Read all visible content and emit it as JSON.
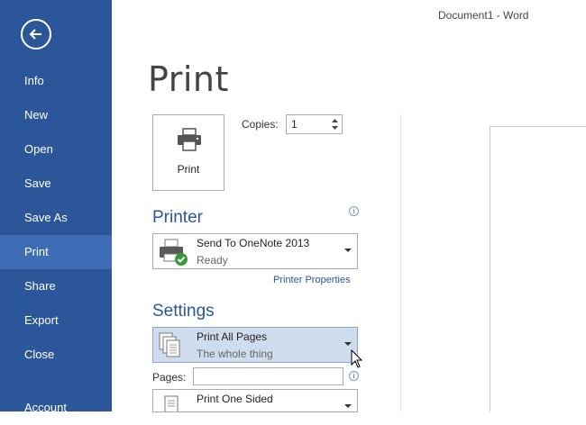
{
  "window": {
    "title": "Document1 - Word"
  },
  "sidebar": {
    "items": [
      {
        "label": "Info"
      },
      {
        "label": "New"
      },
      {
        "label": "Open"
      },
      {
        "label": "Save"
      },
      {
        "label": "Save As"
      },
      {
        "label": "Print",
        "active": true
      },
      {
        "label": "Share"
      },
      {
        "label": "Export"
      },
      {
        "label": "Close"
      },
      {
        "label": "Account"
      }
    ]
  },
  "main": {
    "title": "Print",
    "print_button_label": "Print",
    "copies_label": "Copies:",
    "copies_value": "1",
    "printer_heading": "Printer",
    "printer": {
      "name": "Send To OneNote 2013",
      "status": "Ready"
    },
    "printer_properties_link": "Printer Properties",
    "settings_heading": "Settings",
    "pages_setting": {
      "main": "Print All Pages",
      "sub": "The whole thing"
    },
    "pages_label": "Pages:",
    "pages_value": "",
    "sides_setting": {
      "main": "Print One Sided"
    }
  },
  "colors": {
    "sidebar": "#2b579a",
    "sidebar_active": "#3e6db5",
    "accent": "#2b579a"
  }
}
